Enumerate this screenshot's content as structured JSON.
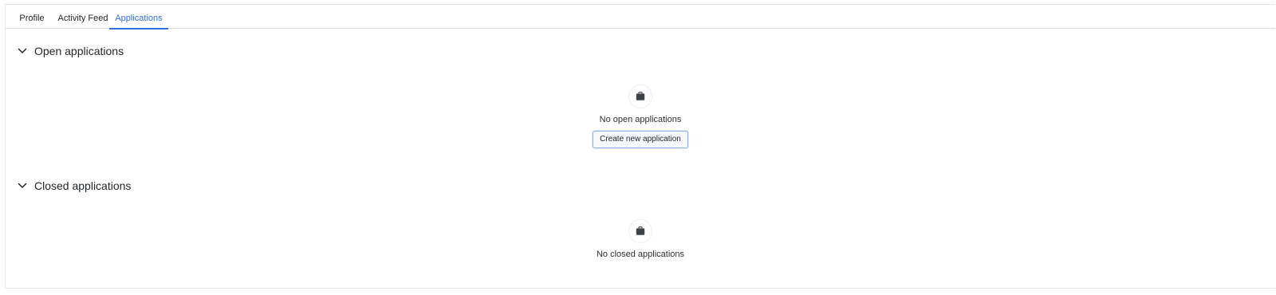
{
  "tabs": [
    {
      "label": "Profile",
      "active": false
    },
    {
      "label": "Activity Feed",
      "active": false
    },
    {
      "label": "Applications",
      "active": true
    }
  ],
  "sections": {
    "open": {
      "title": "Open applications",
      "icon": "briefcase-icon",
      "empty_text": "No open applications",
      "button_label": "Create new application"
    },
    "closed": {
      "title": "Closed applications",
      "icon": "briefcase-icon",
      "empty_text": "No closed applications"
    }
  },
  "colors": {
    "accent": "#2f6fe0",
    "border": "#d9dce1",
    "text": "#1f2328"
  }
}
